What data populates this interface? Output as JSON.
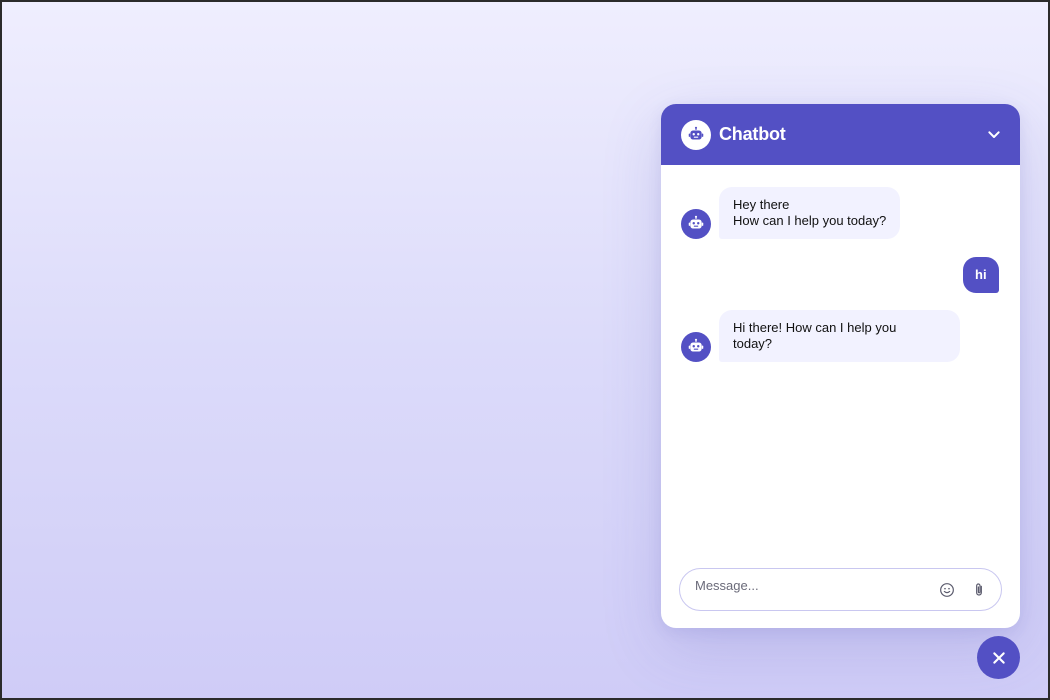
{
  "header": {
    "title": "Chatbot",
    "logo_icon": "robot-icon",
    "toggle_icon": "chevron-down-icon"
  },
  "messages": [
    {
      "role": "bot",
      "lines": [
        "Hey there",
        "How can I help you today?"
      ]
    },
    {
      "role": "user",
      "text": "hi"
    },
    {
      "role": "bot",
      "lines": [
        "Hi there! How can I help you",
        "today?"
      ]
    }
  ],
  "footer": {
    "input_placeholder": "Message...",
    "emoji_icon": "smiley-icon",
    "attach_icon": "paperclip-icon"
  },
  "toggler": {
    "icon": "close-icon"
  },
  "colors": {
    "accent": "#5350c4",
    "bot_bubble": "#f2f2ff",
    "background_top": "#efeefe",
    "background_bottom": "#cfccf7"
  }
}
